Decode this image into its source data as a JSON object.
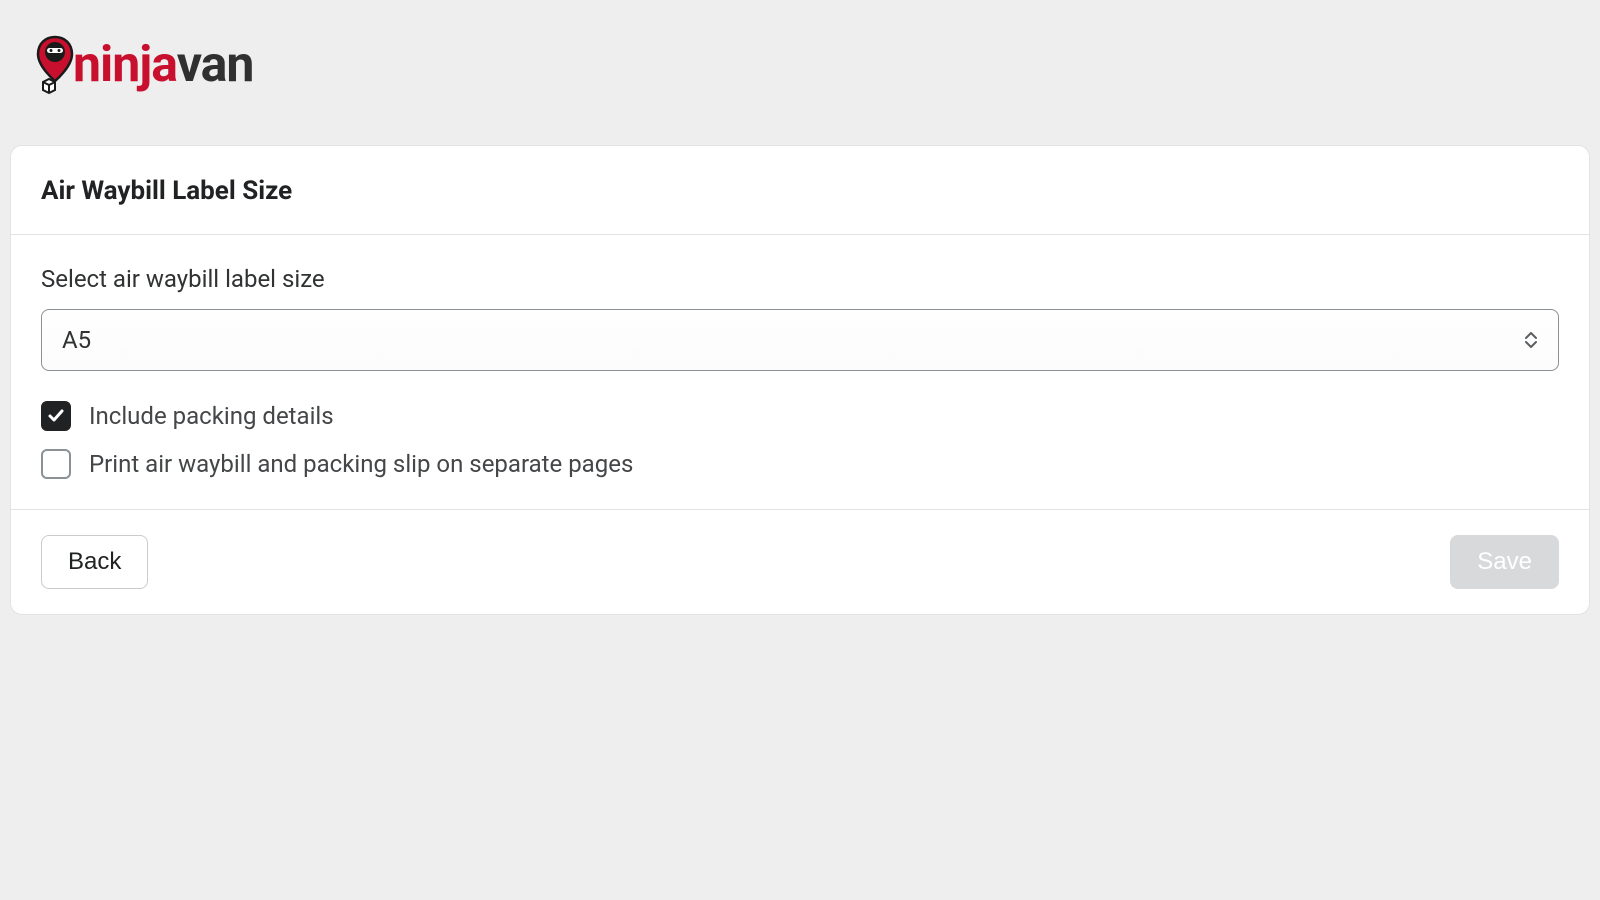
{
  "brand": {
    "name_part1": "ninja",
    "name_part2": "van",
    "colors": {
      "accent": "#c8102e",
      "dark": "#303030"
    }
  },
  "card": {
    "title": "Air Waybill Label Size",
    "field_label": "Select air waybill label size",
    "select": {
      "value": "A5"
    },
    "checkboxes": [
      {
        "label": "Include packing details",
        "checked": true
      },
      {
        "label": "Print air waybill and packing slip on separate pages",
        "checked": false
      }
    ],
    "buttons": {
      "back": "Back",
      "save": "Save"
    }
  }
}
